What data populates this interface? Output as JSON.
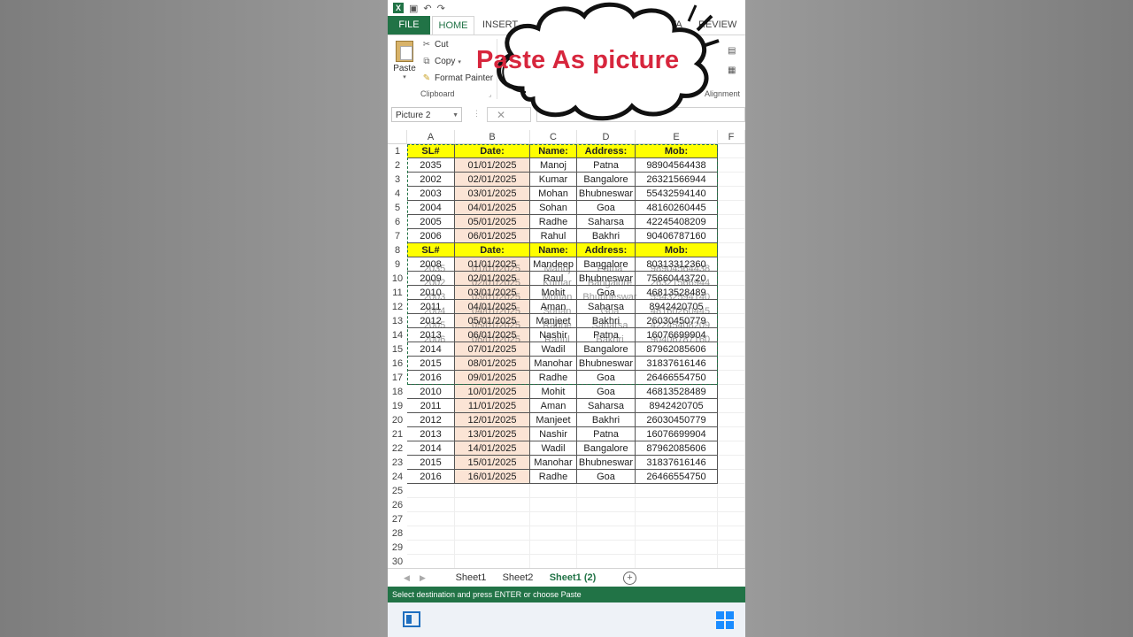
{
  "qat": {
    "undo": "↶",
    "redo": "↷"
  },
  "tabs": [
    {
      "label": "FILE"
    },
    {
      "label": "HOME"
    },
    {
      "label": "INSERT"
    },
    {
      "label": "DATA"
    },
    {
      "label": "REVIEW"
    }
  ],
  "ribbon": {
    "paste": "Paste",
    "cut": "Cut",
    "copy": "Copy",
    "format_painter": "Format Painter",
    "clipboard_group": "Clipboard",
    "alignment_group": "Alignment"
  },
  "formula_bar": {
    "name_box": "Picture 2"
  },
  "callout": {
    "text": "Paste As picture"
  },
  "columns": [
    "A",
    "B",
    "C",
    "D",
    "E",
    "F"
  ],
  "headers": [
    "SL#",
    "Date:",
    "Name:",
    "Address:",
    "Mob:"
  ],
  "rows_table1": [
    [
      "2035",
      "01/01/2025",
      "Manoj",
      "Patna",
      "98904564438"
    ],
    [
      "2002",
      "02/01/2025",
      "Kumar",
      "Bangalore",
      "26321566944"
    ],
    [
      "2003",
      "03/01/2025",
      "Mohan",
      "Bhubneswar",
      "55432594140"
    ],
    [
      "2004",
      "04/01/2025",
      "Sohan",
      "Goa",
      "48160260445"
    ],
    [
      "2005",
      "05/01/2025",
      "Radhe",
      "Saharsa",
      "42245408209"
    ],
    [
      "2006",
      "06/01/2025",
      "Rahul",
      "Bakhri",
      "90406787160"
    ]
  ],
  "rows_picture": [
    [
      "2008",
      "01/01/2025",
      "Mandeep",
      "Bangalore",
      "80313312360"
    ],
    [
      "2009",
      "02/01/2025",
      "Raul",
      "Bhubneswar",
      "75660443720"
    ],
    [
      "2010",
      "03/01/2025",
      "Mohit",
      "Goa",
      "46813528489"
    ],
    [
      "2011",
      "04/01/2025",
      "Aman",
      "Saharsa",
      "8942420705"
    ],
    [
      "2012",
      "05/01/2025",
      "Manjeet",
      "Bakhri",
      "26030450779"
    ],
    [
      "2013",
      "06/01/2025",
      "Nashir",
      "Patna",
      "16076699904"
    ],
    [
      "2014",
      "07/01/2025",
      "Wadil",
      "Bangalore",
      "87962085606"
    ],
    [
      "2015",
      "08/01/2025",
      "Manohar",
      "Bhubneswar",
      "31837616146"
    ],
    [
      "2016",
      "09/01/2025",
      "Radhe",
      "Goa",
      "26466554750"
    ]
  ],
  "rows_below": [
    [
      "2010",
      "10/01/2025",
      "Mohit",
      "Goa",
      "46813528489"
    ],
    [
      "2011",
      "11/01/2025",
      "Aman",
      "Saharsa",
      "8942420705"
    ],
    [
      "2012",
      "12/01/2025",
      "Manjeet",
      "Bakhri",
      "26030450779"
    ],
    [
      "2013",
      "13/01/2025",
      "Nashir",
      "Patna",
      "16076699904"
    ],
    [
      "2014",
      "14/01/2025",
      "Wadil",
      "Bangalore",
      "87962085606"
    ],
    [
      "2015",
      "15/01/2025",
      "Manohar",
      "Bhubneswar",
      "31837616146"
    ],
    [
      "2016",
      "16/01/2025",
      "Radhe",
      "Goa",
      "26466554750"
    ]
  ],
  "row_numbers": [
    "1",
    "2",
    "3",
    "4",
    "5",
    "6",
    "7",
    "8",
    "9",
    "10",
    "11",
    "12",
    "13",
    "14",
    "15",
    "16",
    "17",
    "18",
    "19",
    "20",
    "21",
    "22",
    "23",
    "24",
    "25",
    "26",
    "27",
    "28",
    "29",
    "30"
  ],
  "sheet_tabs": [
    "Sheet1",
    "Sheet2",
    "Sheet1 (2)"
  ],
  "status_text": "Select destination and press ENTER or choose Paste",
  "colors": {
    "excel_green": "#217346",
    "header_yellow": "#ffff00",
    "date_pink": "#fbe4d5",
    "callout_red": "#d7263d"
  }
}
